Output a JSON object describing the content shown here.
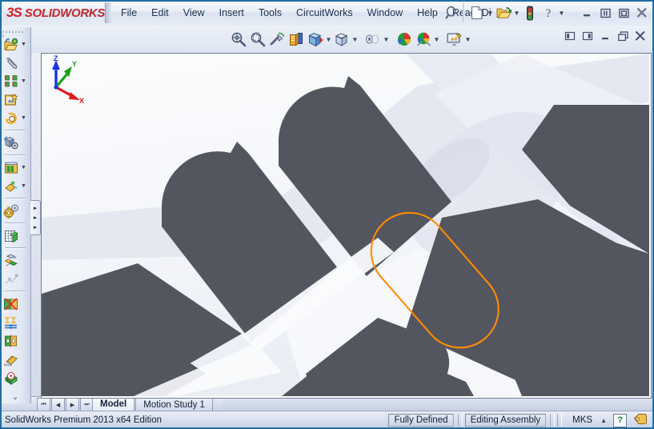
{
  "app": {
    "brand_prefix": "3S",
    "brand_solid": "SOLID",
    "brand_works": "WORKS",
    "accent_red": "#d1232a",
    "selection_orange": "#ff8c00",
    "face_dark": "#54565f",
    "chrome_blue": "#1f6fa5"
  },
  "menubar": {
    "items": [
      {
        "label": "File",
        "name": "menu-file"
      },
      {
        "label": "Edit",
        "name": "menu-edit"
      },
      {
        "label": "View",
        "name": "menu-view"
      },
      {
        "label": "Insert",
        "name": "menu-insert"
      },
      {
        "label": "Tools",
        "name": "menu-tools"
      },
      {
        "label": "CircuitWorks",
        "name": "menu-circuitworks"
      },
      {
        "label": "Window",
        "name": "menu-window"
      },
      {
        "label": "Help",
        "name": "menu-help"
      },
      {
        "label": "Read3Di",
        "name": "menu-read3di"
      }
    ],
    "search_icon": "search-icon",
    "tools": [
      {
        "name": "new-document-icon",
        "has_caret": true
      },
      {
        "name": "open-document-icon",
        "has_caret": true
      },
      {
        "name": "rebuild-traffic-light-icon",
        "has_caret": false
      },
      {
        "name": "help-question-icon",
        "has_caret": true
      }
    ],
    "window_controls": [
      {
        "name": "minimize-button",
        "glyph": "minimize"
      },
      {
        "name": "restore-button",
        "glyph": "restore"
      },
      {
        "name": "maximize-button",
        "glyph": "maximize"
      },
      {
        "name": "close-button",
        "glyph": "close"
      }
    ]
  },
  "view_toolbar": {
    "tools": [
      {
        "name": "zoom-to-fit-icon",
        "has_caret": false
      },
      {
        "name": "zoom-to-area-icon",
        "has_caret": false
      },
      {
        "name": "previous-view-icon",
        "has_caret": false
      },
      {
        "name": "section-view-icon",
        "has_caret": false
      },
      {
        "name": "view-orientation-icon",
        "has_caret": true
      },
      {
        "name": "display-style-icon",
        "has_caret": true
      },
      {
        "name": "hide-show-items-icon",
        "has_caret": true
      },
      {
        "name": "edit-appearance-icon",
        "has_caret": false
      },
      {
        "name": "apply-scene-icon",
        "has_caret": true
      },
      {
        "name": "view-settings-icon",
        "has_caret": true
      }
    ],
    "document_controls": [
      {
        "name": "restore-down-left-button"
      },
      {
        "name": "restore-down-right-button"
      },
      {
        "name": "document-minimize-button"
      },
      {
        "name": "document-restore-button"
      },
      {
        "name": "document-close-button"
      }
    ]
  },
  "left_toolbar": {
    "groups": [
      {
        "items": [
          {
            "name": "edit-component-icon",
            "has_caret": true
          },
          {
            "name": "insert-components-icon",
            "has_caret": false
          },
          {
            "name": "linear-component-pattern-icon",
            "has_caret": true
          },
          {
            "name": "smart-fasteners-icon",
            "has_caret": false
          },
          {
            "name": "move-component-icon",
            "has_caret": true
          }
        ]
      },
      {
        "items": [
          {
            "name": "show-hidden-components-icon",
            "has_caret": false
          }
        ]
      },
      {
        "items": [
          {
            "name": "assembly-features-icon",
            "has_caret": true
          },
          {
            "name": "reference-geometry-icon",
            "has_caret": true
          }
        ]
      },
      {
        "items": [
          {
            "name": "new-motion-study-icon",
            "has_caret": false
          }
        ]
      },
      {
        "items": [
          {
            "name": "bill-of-materials-icon",
            "has_caret": false
          }
        ]
      },
      {
        "items": [
          {
            "name": "exploded-view-icon",
            "has_caret": false
          },
          {
            "name": "explode-line-sketch-icon",
            "has_caret": false
          }
        ]
      },
      {
        "items": [
          {
            "name": "interference-detection-icon",
            "has_caret": false
          },
          {
            "name": "clearance-verification-icon",
            "has_caret": false
          },
          {
            "name": "hole-alignment-icon",
            "has_caret": false
          },
          {
            "name": "measure-icon",
            "has_caret": false
          },
          {
            "name": "performance-evaluation-icon",
            "has_caret": false
          }
        ]
      }
    ],
    "overflow_glyph": "chevron-double-down-icon"
  },
  "panel_flyout": {
    "name": "feature-manager-flyout-handle",
    "arrows": [
      "▸",
      "▸",
      "▸"
    ]
  },
  "viewport": {
    "name": "graphics-area",
    "background_top": "#fafbfd",
    "background_bottom": "#eceff6",
    "selected_entity": "slot-profile-selection",
    "triad": {
      "name": "coordinate-triad",
      "axes": [
        {
          "label": "X",
          "color": "#e01b1b"
        },
        {
          "label": "Y",
          "color": "#16a016"
        },
        {
          "label": "Z",
          "color": "#1b34e0"
        }
      ]
    }
  },
  "tabstrip": {
    "nav_buttons": [
      {
        "name": "tab-first-button",
        "glyph": "⏮"
      },
      {
        "name": "tab-prev-button",
        "glyph": "◀"
      },
      {
        "name": "tab-next-button",
        "glyph": "▶"
      },
      {
        "name": "tab-last-button",
        "glyph": "⏭"
      }
    ],
    "tabs": [
      {
        "label": "Model",
        "active": true,
        "name": "tab-model"
      },
      {
        "label": "Motion Study 1",
        "active": false,
        "name": "tab-motion-study-1"
      }
    ]
  },
  "statusbar": {
    "edition": "SolidWorks Premium 2013 x64 Edition",
    "sketch_state": "Fully Defined",
    "edit_mode": "Editing Assembly",
    "units": "MKS",
    "units_caret": "▲",
    "help_glyph": "?",
    "tag_icon": "tag-icon"
  }
}
